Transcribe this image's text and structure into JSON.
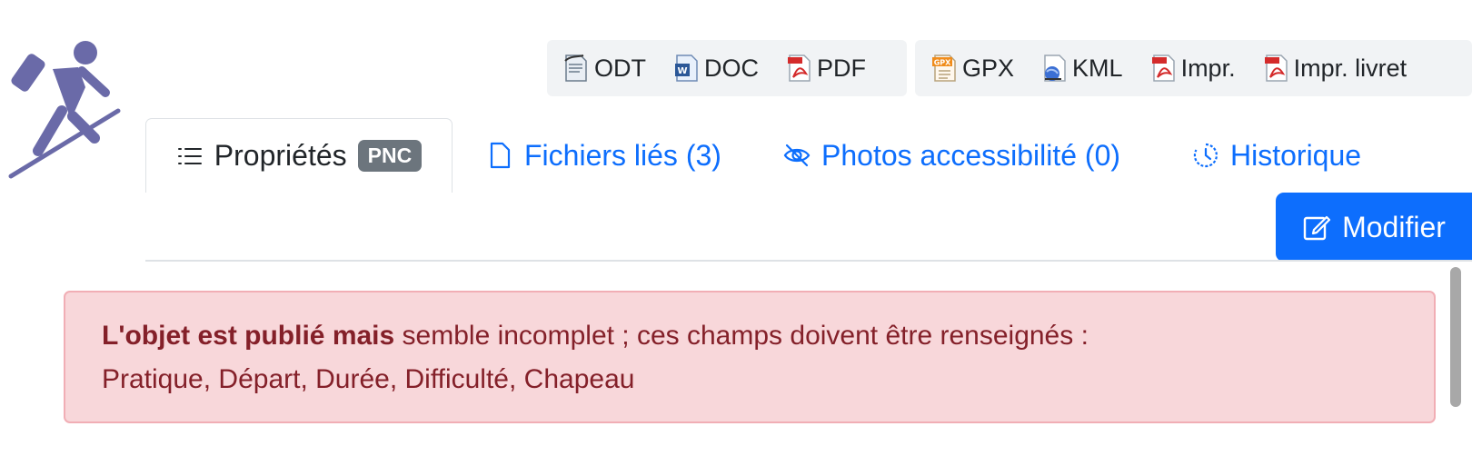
{
  "toolbar": {
    "group1": [
      {
        "label": "ODT",
        "icon": "odt-file-icon"
      },
      {
        "label": "DOC",
        "icon": "doc-file-icon"
      },
      {
        "label": "PDF",
        "icon": "pdf-file-icon"
      }
    ],
    "group2": [
      {
        "label": "GPX",
        "icon": "gpx-file-icon"
      },
      {
        "label": "KML",
        "icon": "kml-file-icon"
      },
      {
        "label": "Impr.",
        "icon": "pdf-file-icon"
      },
      {
        "label": "Impr. livret",
        "icon": "pdf-file-icon"
      }
    ]
  },
  "tabs": [
    {
      "label": "Propriétés",
      "badge": "PNC",
      "icon": "list-icon",
      "active": true
    },
    {
      "label": "Fichiers liés (3)",
      "icon": "file-icon"
    },
    {
      "label": "Photos accessibilité (0)",
      "icon": "eye-slash-icon"
    },
    {
      "label": "Historique",
      "icon": "clock-history-icon"
    }
  ],
  "actions": {
    "modify_label": "Modifier"
  },
  "alert": {
    "bold": "L'objet est publié mais",
    "text": " semble incomplet ; ces champs doivent être renseignés :",
    "fields": "Pratique, Départ, Durée, Difficulté, Chapeau"
  },
  "colors": {
    "primary": "#0d6efd",
    "logo": "#6a6aa8",
    "alert_bg": "#f8d7da",
    "alert_text": "#842029",
    "badge_bg": "#6c757d"
  }
}
